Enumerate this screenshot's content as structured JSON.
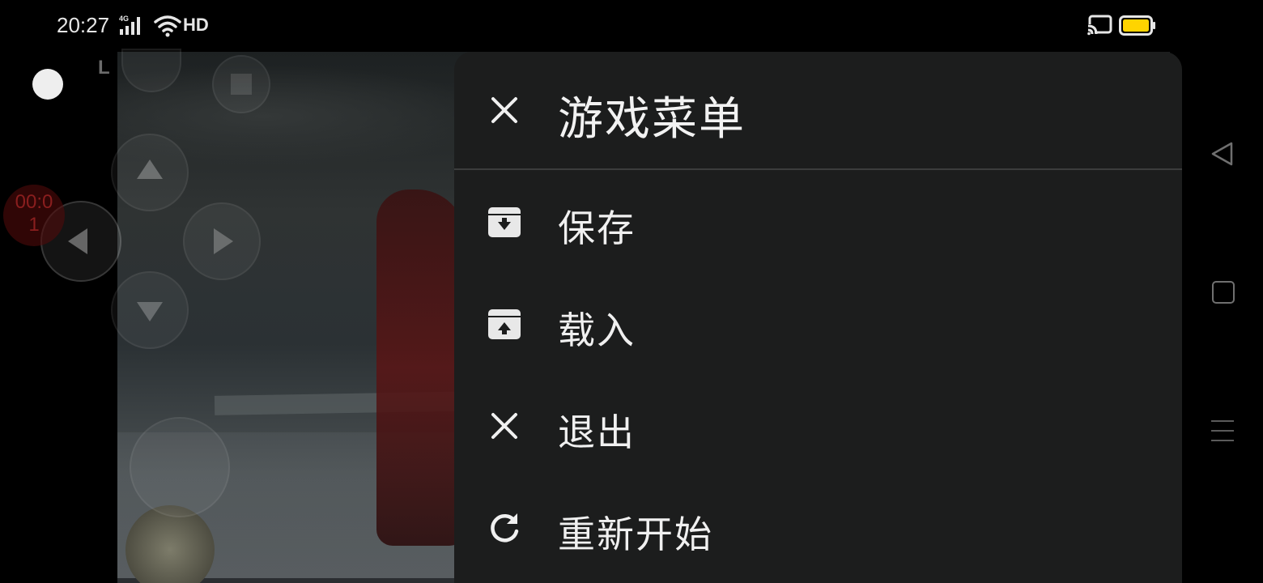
{
  "status_bar": {
    "time": "20:27",
    "network_type": "4G",
    "hd_label": "HD",
    "icons": [
      "signal-icon",
      "wifi-icon",
      "cast-icon",
      "battery-icon"
    ],
    "battery_color": "#ffd400"
  },
  "overlay": {
    "shoulder_label": "L",
    "timer_text": "00:0\n1"
  },
  "menu": {
    "title": "游戏菜单",
    "close_icon": "close-icon",
    "items": [
      {
        "label": "保存",
        "icon": "save-archive-icon"
      },
      {
        "label": "载入",
        "icon": "load-archive-icon"
      },
      {
        "label": "退出",
        "icon": "exit-x-icon"
      },
      {
        "label": "重新开始",
        "icon": "restart-icon"
      }
    ]
  },
  "nav_bar": {
    "icons": [
      "back-icon",
      "home-icon",
      "recents-icon"
    ]
  },
  "colors": {
    "menu_background": "#1c1d1d",
    "divider": "#3c3d3d",
    "text": "#f0f0f0"
  }
}
